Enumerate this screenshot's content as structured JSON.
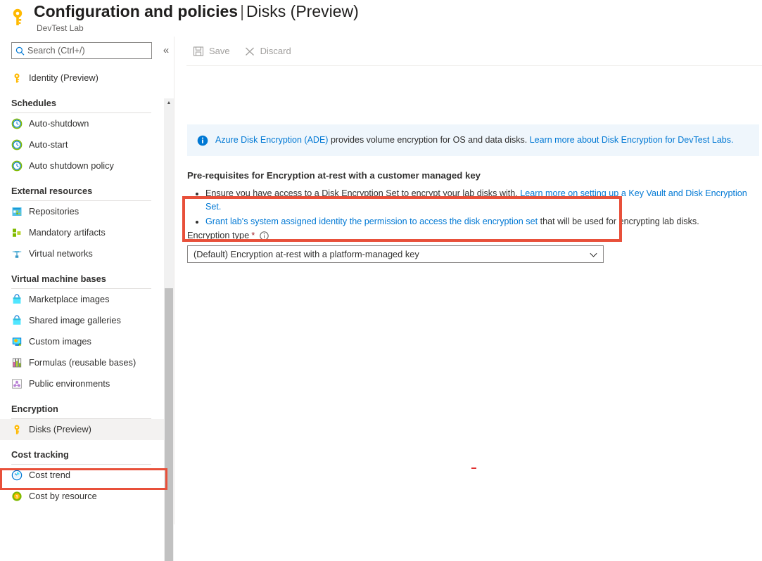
{
  "header": {
    "icon": "key-icon",
    "title_main": "Configuration and policies",
    "title_separator": "|",
    "title_sub": "Disks (Preview)",
    "subtitle": "DevTest Lab"
  },
  "search": {
    "placeholder": "Search (Ctrl+/)",
    "value": "",
    "icon": "search-icon"
  },
  "collapse": {
    "label": "«",
    "name": "collapse-sidebar-button"
  },
  "sidebar": {
    "scrollbar": {
      "up_arrow": "▲"
    },
    "entries": [
      {
        "kind": "item",
        "label": "Identity (Preview)",
        "icon": "key-icon",
        "selected": false
      },
      {
        "kind": "group",
        "label": "Schedules"
      },
      {
        "kind": "item",
        "label": "Auto-shutdown",
        "icon": "clock-icon",
        "selected": false
      },
      {
        "kind": "item",
        "label": "Auto-start",
        "icon": "clock-icon",
        "selected": false
      },
      {
        "kind": "item",
        "label": "Auto shutdown policy",
        "icon": "clock-icon",
        "selected": false
      },
      {
        "kind": "group",
        "label": "External resources"
      },
      {
        "kind": "item",
        "label": "Repositories",
        "icon": "repository-icon",
        "selected": false
      },
      {
        "kind": "item",
        "label": "Mandatory artifacts",
        "icon": "artifacts-icon",
        "selected": false
      },
      {
        "kind": "item",
        "label": "Virtual networks",
        "icon": "network-icon",
        "selected": false
      },
      {
        "kind": "group",
        "label": "Virtual machine bases"
      },
      {
        "kind": "item",
        "label": "Marketplace images",
        "icon": "marketplace-icon",
        "selected": false
      },
      {
        "kind": "item",
        "label": "Shared image galleries",
        "icon": "marketplace-icon",
        "selected": false
      },
      {
        "kind": "item",
        "label": "Custom images",
        "icon": "custom-image-icon",
        "selected": false
      },
      {
        "kind": "item",
        "label": "Formulas (reusable bases)",
        "icon": "formulas-icon",
        "selected": false
      },
      {
        "kind": "item",
        "label": "Public environments",
        "icon": "environments-icon",
        "selected": false
      },
      {
        "kind": "group",
        "label": "Encryption"
      },
      {
        "kind": "item",
        "label": "Disks (Preview)",
        "icon": "key-icon",
        "selected": true
      },
      {
        "kind": "group",
        "label": "Cost tracking"
      },
      {
        "kind": "item",
        "label": "Cost trend",
        "icon": "cost-trend-icon",
        "selected": false
      },
      {
        "kind": "item",
        "label": "Cost by resource",
        "icon": "cost-resource-icon",
        "selected": false
      }
    ]
  },
  "toolbar": {
    "save_label": "Save",
    "save_icon": "save-icon",
    "save_disabled": true,
    "discard_label": "Discard",
    "discard_icon": "close-x-icon",
    "discard_disabled": true
  },
  "banner": {
    "icon": "info-icon",
    "link_text": "Azure Disk Encryption (ADE)",
    "body_text": " provides volume encryption for OS and data disks. ",
    "link2_text": "Learn more about Disk Encryption for DevTest Labs."
  },
  "prerequisites": {
    "heading": "Pre-requisites for Encryption at-rest with a customer managed key",
    "bullet1_text": "Ensure you have access to a Disk Encryption Set to encrypt your lab disks with. ",
    "bullet1_link": "Learn more on setting up a Key Vault and Disk Encryption Set.",
    "bullet2_link": "Grant lab's system assigned identity the permission to access the disk encryption set",
    "bullet2_text": " that will be used for encrypting lab disks."
  },
  "encryption_field": {
    "label": "Encryption type",
    "required_marker": "*",
    "info_icon": "info-circle-icon",
    "selected_value": "(Default) Encryption at-rest with a platform-managed key",
    "chevron_icon": "chevron-down-icon",
    "options": [
      "(Default) Encryption at-rest with a platform-managed key"
    ]
  },
  "colors": {
    "highlight_red": "#e8503a",
    "accent_blue": "#0078d4",
    "banner_bg": "#eff6fc",
    "selected_bg": "#f3f2f1",
    "required_red": "#a4262c",
    "disabled_text": "#a19f9d"
  }
}
